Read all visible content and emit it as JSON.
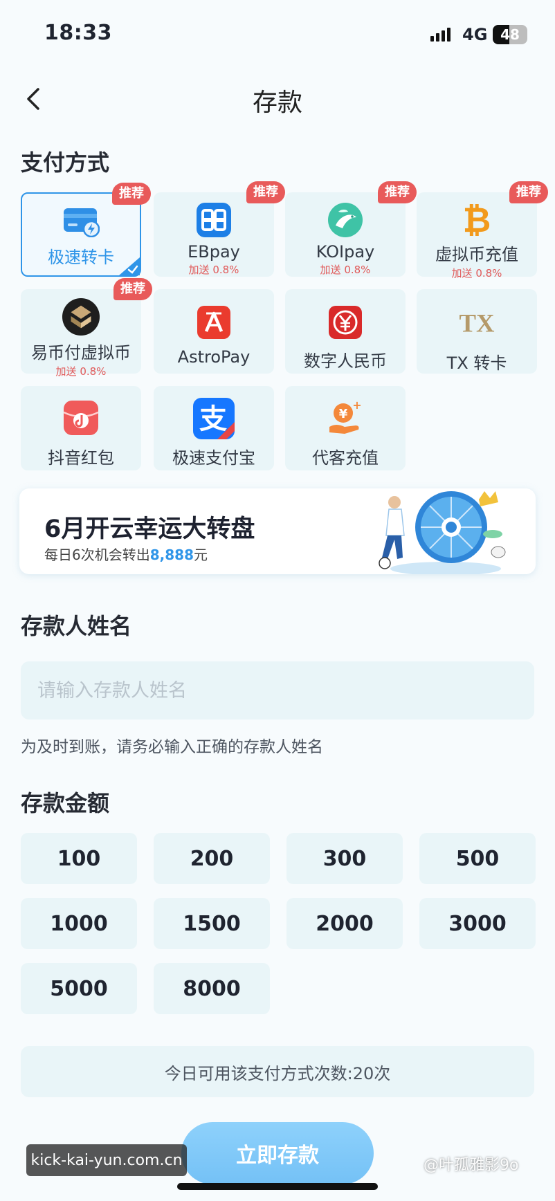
{
  "status_bar": {
    "time": "18:33",
    "network": "4G",
    "battery": "48",
    "battery_level": 0.48
  },
  "header": {
    "title": "存款"
  },
  "payment": {
    "section_title": "支付方式",
    "methods": [
      {
        "name": "极速转卡",
        "bonus": "",
        "badge": "推荐",
        "icon": "bank-card-lightning-icon"
      },
      {
        "name": "EBpay",
        "bonus": "加送 0.8%",
        "badge": "推荐",
        "icon": "ebpay-logo-icon"
      },
      {
        "name": "KOIpay",
        "bonus": "加送 0.8%",
        "badge": "推荐",
        "icon": "koi-fish-icon"
      },
      {
        "name": "虚拟币充值",
        "bonus": "加送 0.8%",
        "badge": "推荐",
        "icon": "bitcoin-icon"
      },
      {
        "name": "易币付虚拟币",
        "bonus": "加送 0.8%",
        "badge": "推荐",
        "icon": "yibifu-logo-icon"
      },
      {
        "name": "AstroPay",
        "bonus": "",
        "badge": "",
        "icon": "astropay-logo-icon"
      },
      {
        "name": "数字人民币",
        "bonus": "",
        "badge": "",
        "icon": "digital-rmb-icon"
      },
      {
        "name": "TX 转卡",
        "bonus": "",
        "badge": "",
        "icon": "tx-logo-icon"
      },
      {
        "name": "抖音红包",
        "bonus": "",
        "badge": "",
        "icon": "douyin-red-packet-icon"
      },
      {
        "name": "极速支付宝",
        "bonus": "",
        "badge": "",
        "icon": "alipay-icon"
      },
      {
        "name": "代客充值",
        "bonus": "",
        "badge": "",
        "icon": "hand-coin-icon"
      }
    ],
    "selected_index": 0
  },
  "banner": {
    "title": "6月开云幸运大转盘",
    "subtitle_prefix": "每日6次机会转出",
    "subtitle_amount": "8,888",
    "subtitle_suffix": "元"
  },
  "depositor": {
    "section_title": "存款人姓名",
    "placeholder": "请输入存款人姓名",
    "value": "",
    "hint": "为及时到账，请务必输入正确的存款人姓名"
  },
  "amount": {
    "section_title": "存款金额",
    "options": [
      "100",
      "200",
      "300",
      "500",
      "1000",
      "1500",
      "2000",
      "3000",
      "5000",
      "8000"
    ]
  },
  "limit": {
    "text": "今日可用该支付方式次数:20次"
  },
  "submit": {
    "label": "立即存款"
  },
  "watermarks": {
    "left": "kick-kai-yun.com.cn",
    "right": "@叶孤雅影9o"
  },
  "colors": {
    "accent": "#2f95e8",
    "badge": "#e85a5a",
    "tile_bg": "#e9f5f8",
    "submit": "#7cc6f8"
  }
}
